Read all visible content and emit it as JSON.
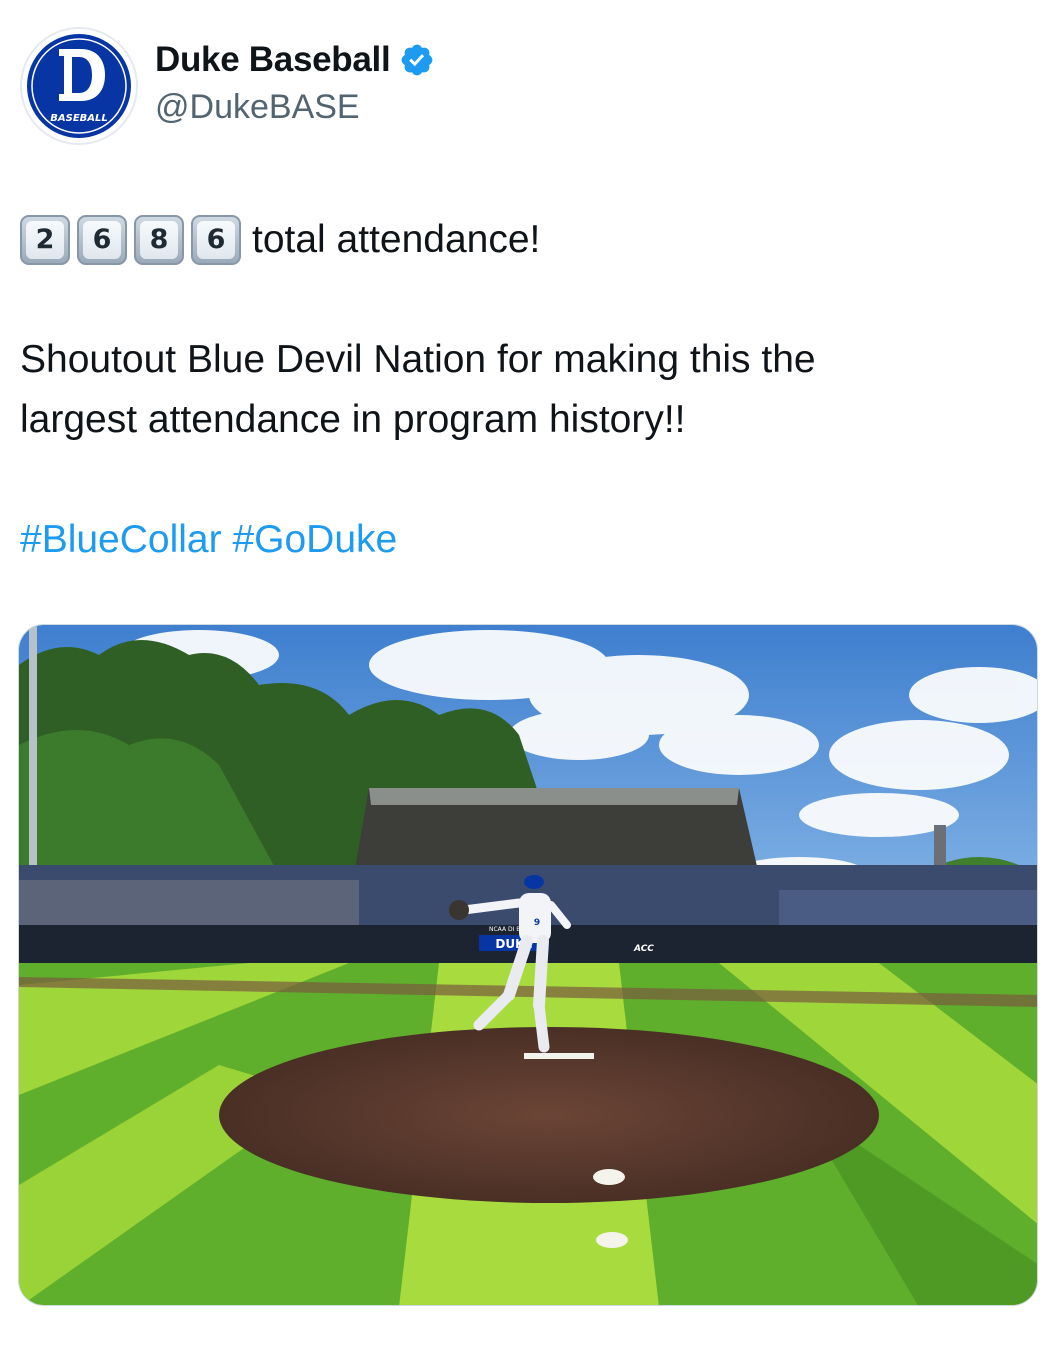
{
  "account": {
    "display_name": "Duke Baseball",
    "handle": "@DukeBASE",
    "verified": true,
    "avatar": {
      "logo_letter": "D",
      "logo_text": "BASEBALL",
      "color": "#0736a4"
    }
  },
  "tweet": {
    "keycaps": [
      "2",
      "6",
      "8",
      "6"
    ],
    "first_line_text": "total attendance!",
    "paragraph_line1": "Shoutout Blue Devil Nation for making this the",
    "paragraph_line2": "largest attendance in program history!!",
    "hashtags": [
      "#BlueCollar",
      "#GoDuke"
    ]
  },
  "media": {
    "scoreboard_text": "DUKE",
    "banner_text": "NCAA DI BASEBALL",
    "sponsor_text": "ACC",
    "jersey_number": "9",
    "colors": {
      "sky": "#4f8fd6",
      "grass_light": "#9fd63a",
      "grass_dark": "#4f9a25",
      "mound": "#5a3a2e",
      "duke_blue": "#0736a4"
    }
  },
  "icons": {
    "verified": "verified-badge-icon"
  }
}
